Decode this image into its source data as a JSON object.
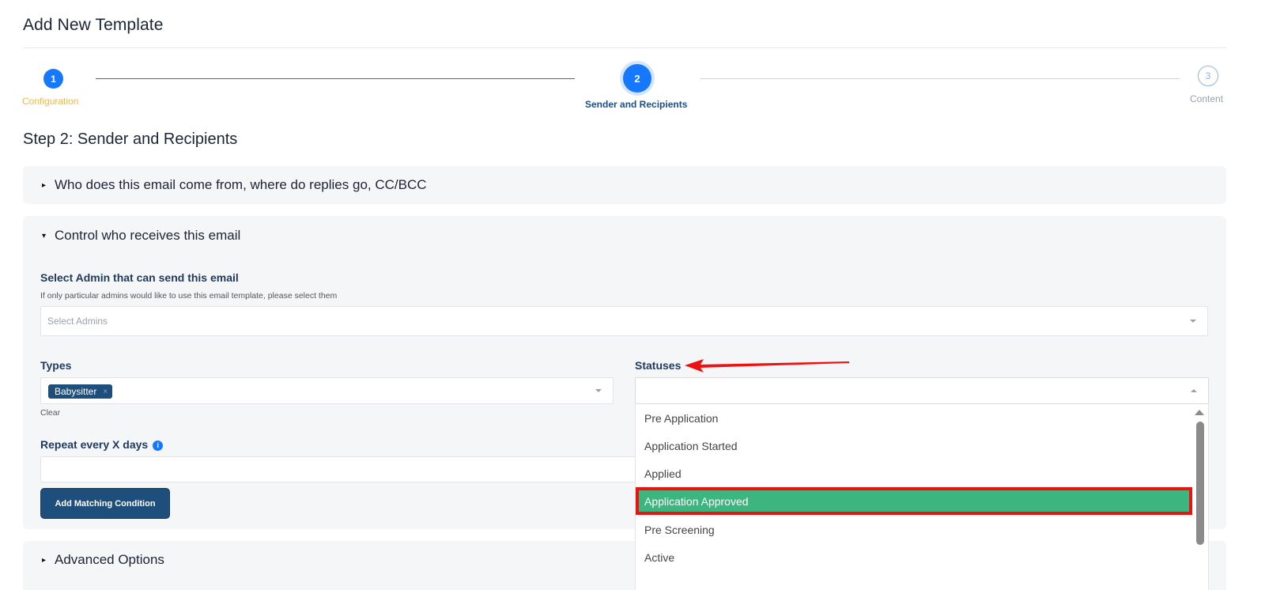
{
  "page": {
    "title": "Add New Template"
  },
  "stepper": {
    "steps": [
      {
        "number": "1",
        "label": "Configuration"
      },
      {
        "number": "2",
        "label": "Sender and Recipients"
      },
      {
        "number": "3",
        "label": "Content"
      }
    ],
    "current_step": 2
  },
  "section": {
    "heading": "Step 2: Sender and Recipients"
  },
  "panels": {
    "sender": {
      "title": "Who does this email come from, where do replies go, CC/BCC",
      "expanded": false
    },
    "recipients": {
      "title": "Control who receives this email",
      "expanded": true
    },
    "advanced": {
      "title": "Advanced Options",
      "expanded": false
    }
  },
  "admins": {
    "label": "Select Admin that can send this email",
    "help": "If only particular admins would like to use this email template, please select them",
    "placeholder": "Select Admins"
  },
  "types": {
    "label": "Types",
    "chips": [
      "Babysitter"
    ],
    "chip_remove_glyph": "×",
    "clear_label": "Clear"
  },
  "statuses": {
    "label": "Statuses",
    "options": [
      "Pre Application",
      "Application Started",
      "Applied",
      "Application Approved",
      "Pre Screening",
      "Active"
    ],
    "highlighted_option": "Application Approved"
  },
  "repeat": {
    "label": "Repeat every X days",
    "info_glyph": "i",
    "value": ""
  },
  "buttons": {
    "add_matching_condition": "Add Matching Condition"
  },
  "icons": {
    "caret_collapsed": "caret-right-icon",
    "caret_expanded": "caret-down-icon",
    "select_arrow": "chevron-down-icon",
    "info": "info-icon"
  },
  "colors": {
    "primary": "#1677ff",
    "navy": "#1e4e7c",
    "completed_label": "#f5b83d",
    "highlight_green": "#3db57f",
    "annotation_red": "#ee1111"
  }
}
